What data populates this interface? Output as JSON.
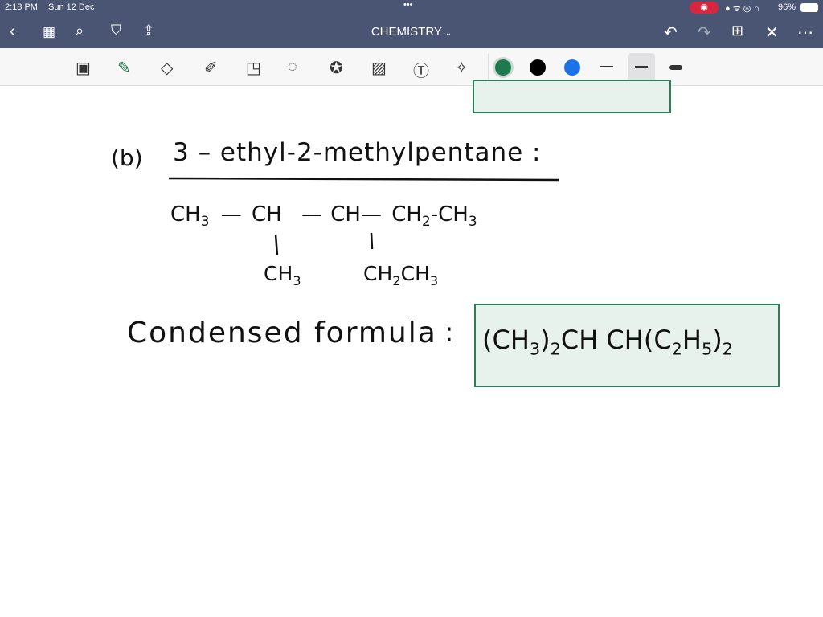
{
  "status": {
    "time": "2:18 PM",
    "date": "Sun 12 Dec",
    "battery": "96%"
  },
  "header": {
    "title": "CHEMISTRY",
    "dropdown_icon": "chevron-down-icon"
  },
  "toolbar": {
    "colors": [
      "#1e7a4e",
      "#000000",
      "#1a73e8"
    ],
    "selected_color": "#1e7a4e"
  },
  "note": {
    "part_label": "(b)",
    "compound_name": "3 – ethyl-2-methylpentane :",
    "chain": {
      "c1": "CH",
      "c1_sub": "3",
      "bond1": "—",
      "c2": "CH",
      "bond2": "—",
      "c3": "CH—",
      "c4": "CH",
      "c4_sub": "2",
      "bond3": "-",
      "c5": "CH",
      "c5_sub": "3"
    },
    "branch1": {
      "text": "CH",
      "sub": "3"
    },
    "branch2": {
      "a": "CH",
      "a_sub": "2",
      "b": "CH",
      "b_sub": "3"
    },
    "condensed_label": "Condensed formula",
    "colon": ":",
    "formula": {
      "p1": "(CH",
      "s1": "3",
      "p2": ")",
      "s2": "2",
      "p3": "CH CH(C",
      "s3": "2",
      "p4": "H",
      "s4": "5",
      "p5": ")",
      "s5": "2"
    }
  }
}
